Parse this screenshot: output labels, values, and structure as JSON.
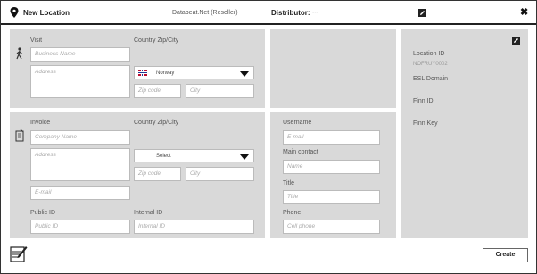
{
  "titlebar": {
    "title": "New Location",
    "company": "Databeat.Net (Reseller)",
    "distributor_label": "Distributor:",
    "distributor_value": "---",
    "edit_icon": "edit-icon",
    "close_icon": "close-icon",
    "close_glyph": "✖"
  },
  "visit": {
    "section_label": "Visit",
    "icon": "walking-person-icon",
    "business_placeholder": "Business Name",
    "address_placeholder": "Address",
    "country_label": "Country Zip/City",
    "country_value": "Norway",
    "zip_placeholder": "Zip code",
    "city_placeholder": "City"
  },
  "invoice": {
    "section_label": "Invoice",
    "icon": "invoice-document-icon",
    "company_placeholder": "Company Name",
    "address_placeholder": "Address",
    "email_placeholder": "E-mail",
    "country_label": "Country Zip/City",
    "country_value": "Select",
    "zip_placeholder": "Zip code",
    "city_placeholder": "City",
    "public_id_label": "Public ID",
    "public_id_placeholder": "Public ID",
    "internal_id_label": "Internal ID",
    "internal_id_placeholder": "Internal ID"
  },
  "contact": {
    "username_label": "Username",
    "username_placeholder": "E-mail",
    "main_contact_label": "Main contact",
    "main_contact_placeholder": "Name",
    "title_label": "Title",
    "title_placeholder": "Title",
    "phone_label": "Phone",
    "phone_placeholder": "Cell phone"
  },
  "info": {
    "location_id_label": "Location ID",
    "location_id_value": "NOFRUY0002",
    "esl_domain_label": "ESL Domain",
    "finn_id_label": "Finn ID",
    "finn_key_label": "Finn Key"
  },
  "footer": {
    "create_label": "Create",
    "notes_icon": "notes-edit-icon"
  }
}
